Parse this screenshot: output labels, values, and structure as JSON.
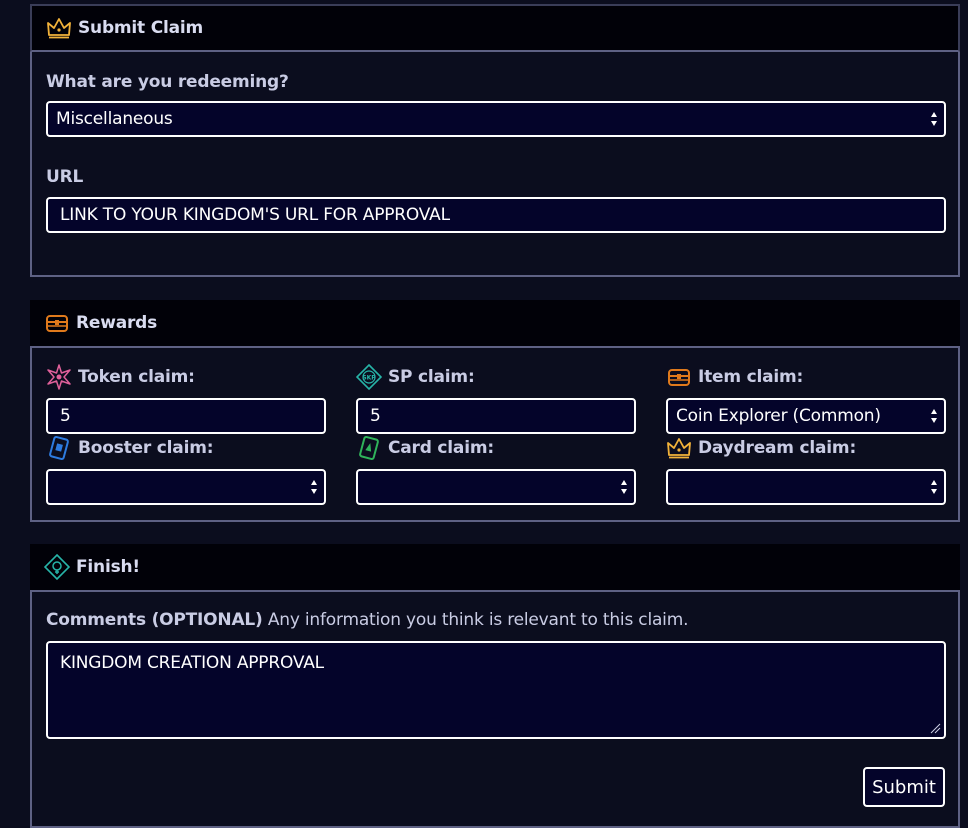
{
  "submit_claim": {
    "title": "Submit Claim",
    "redeem_label": "What are you redeeming?",
    "redeem_selected": "Miscellaneous",
    "url_label": "URL",
    "url_value": "LINK TO YOUR KINGDOM'S URL FOR APPROVAL"
  },
  "rewards": {
    "title": "Rewards",
    "token_label": "Token claim:",
    "token_value": "5",
    "sp_label": "SP claim:",
    "sp_value": "5",
    "item_label": "Item claim:",
    "item_selected": "Coin Explorer (Common)",
    "booster_label": "Booster claim:",
    "booster_selected": "",
    "card_label": "Card claim:",
    "card_selected": "",
    "daydream_label": "Daydream claim:",
    "daydream_selected": ""
  },
  "finish": {
    "title": "Finish!",
    "comments_label_bold": "Comments (OPTIONAL)",
    "comments_label_rest": " Any information you think is relevant to this claim.",
    "comments_value": "KINGDOM CREATION APPROVAL",
    "submit_label": "Submit"
  },
  "icons": {
    "crown": "crown-icon",
    "chest": "treasure-chest-icon",
    "token": "token-star-icon",
    "sp": "skp-diamond-icon",
    "booster": "booster-card-icon",
    "card": "card-icon",
    "finish": "finish-diamond-icon"
  },
  "colors": {
    "background": "#0b0d1e",
    "header": "#010108",
    "field": "#04042a",
    "border": "#5e6184",
    "label": "#c9cce4",
    "crown": "#f2b23a",
    "chest": "#e07a1c",
    "token": "#e0609a",
    "sp": "#27b4a8",
    "booster": "#2d7be0",
    "card": "#2fb35a"
  }
}
